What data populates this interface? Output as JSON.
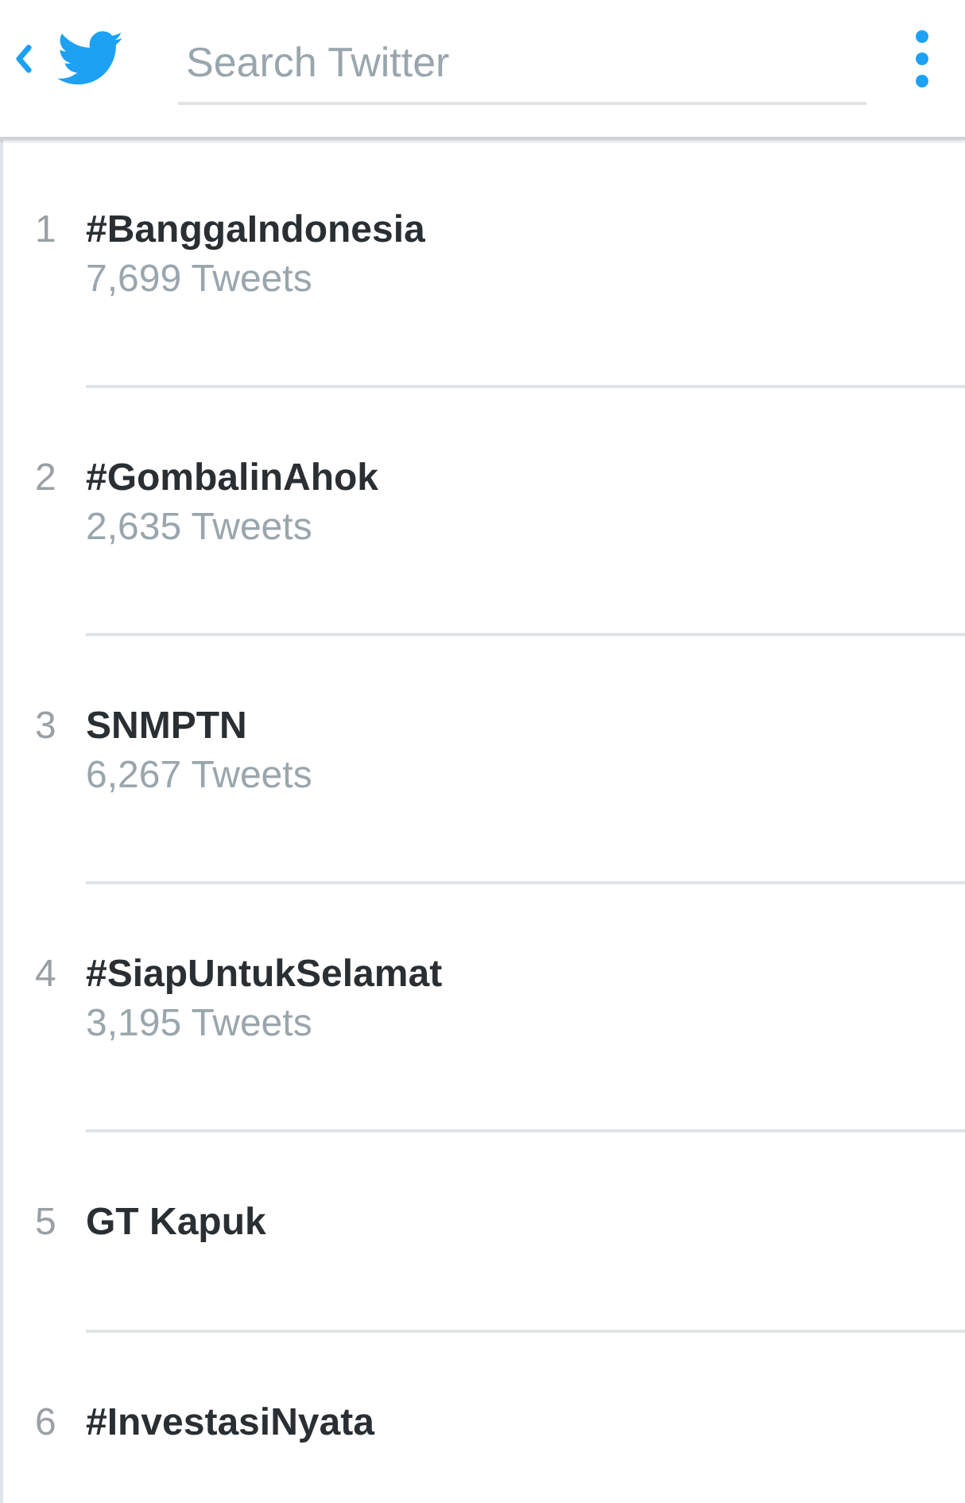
{
  "search": {
    "placeholder": "Search Twitter"
  },
  "trends": [
    {
      "rank": "1",
      "name": "#BanggaIndonesia",
      "count": "7,699 Tweets"
    },
    {
      "rank": "2",
      "name": "#GombalinAhok",
      "count": "2,635 Tweets"
    },
    {
      "rank": "3",
      "name": "SNMPTN",
      "count": "6,267 Tweets"
    },
    {
      "rank": "4",
      "name": "#SiapUntukSelamat",
      "count": "3,195 Tweets"
    },
    {
      "rank": "5",
      "name": "GT Kapuk"
    },
    {
      "rank": "6",
      "name": "#InvestasiNyata"
    }
  ]
}
